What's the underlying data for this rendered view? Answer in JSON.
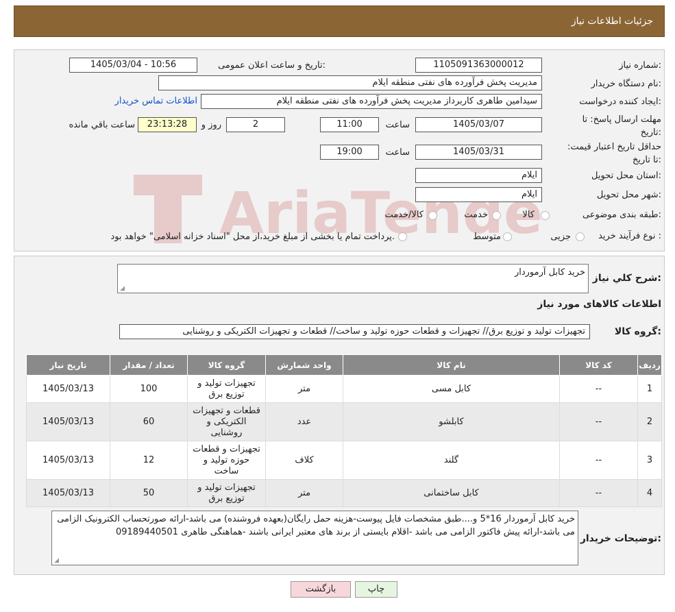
{
  "header": {
    "title": "جزئیات اطلاعات نیاز"
  },
  "fields": {
    "need_number_label": "شماره نیاز:",
    "need_number": "1105091363000012",
    "announce_label": "تاریخ و ساعت اعلان عمومی:",
    "announce_value": "1405/03/04 - 10:56",
    "buyer_org_label": "نام دستگاه خریدار:",
    "buyer_org": "مدیریت پخش فرآورده های نفتی منطقه ایلام",
    "creator_label": "ایجاد کننده درخواست:",
    "creator": "سیدامین طاهری کاربرداز مدیریت پخش فرآورده های نفتی منطقه ایلام",
    "contact_link": "اطلاعات تماس خریدار",
    "reply_deadline_label": "مهلت ارسال پاسخ: تا تاریخ:",
    "reply_date": "1405/03/07",
    "time_label": "ساعت",
    "reply_time": "11:00",
    "days": "2",
    "days_label": "روز و",
    "remaining_time": "23:13:28",
    "remaining_label": "ساعت باقي مانده",
    "price_validity_label": "حداقل تاریخ اعتبار قیمت: تا تاریخ:",
    "price_date": "1405/03/31",
    "price_time": "19:00",
    "province_label": "استان محل تحویل:",
    "province": "ایلام",
    "city_label": "شهر محل تحویل:",
    "city": "ایلام",
    "category_label": "طبقه بندی موضوعی:",
    "category_options": [
      "کالا",
      "خدمت",
      "کالا/خدمت"
    ],
    "process_label": "نوع فرآیند خرید :",
    "process_options": [
      "جزیی",
      "متوسط"
    ],
    "process_note": "پرداخت تمام یا بخشی از مبلغ خرید،از محل \"اسناد خزانه اسلامی\" خواهد بود."
  },
  "summary": {
    "label": "شرح کلي نیاز:",
    "value": "خرید کابل آرموردار",
    "items_title": "اطلاعات کالاهای مورد نیاز",
    "group_label": "گروه کالا:",
    "group_value": "تجهیزات تولید و توزیع برق// تجهیزات و قطعات حوزه تولید و ساخت// قطعات و تجهیزات الکتریکی و روشنایی"
  },
  "table": {
    "headers": [
      "ردیف",
      "کد کالا",
      "نام کالا",
      "واحد شمارش",
      "گروه کالا",
      "تعداد / مقدار",
      "تاریخ نیاز"
    ],
    "rows": [
      [
        "1",
        "--",
        "کابل مسی",
        "متر",
        "تجهیزات تولید و توزیع برق",
        "100",
        "1405/03/13"
      ],
      [
        "2",
        "--",
        "کابلشو",
        "عدد",
        "قطعات و تجهیزات الکتریکی و روشنایی",
        "60",
        "1405/03/13"
      ],
      [
        "3",
        "--",
        "گلند",
        "کلاف",
        "تجهیزات و قطعات حوزه تولید و ساخت",
        "12",
        "1405/03/13"
      ],
      [
        "4",
        "--",
        "کابل ساختمانی",
        "متر",
        "تجهیزات تولید و توزیع برق",
        "50",
        "1405/03/13"
      ]
    ]
  },
  "buyer_notes": {
    "label": "توضیحات خریدار:",
    "value": "خرید کابل آرموردار 16*5 و....طبق مشخصات فایل پیوست-هزینه حمل رایگان(بعهده فروشنده) می باشد-ارائه صورتحساب الکترونیک الزامی می باشد-ارائه پیش فاکتور الزامی می باشد -اقلام بایستی از برند های معتبر ایرانی باشند -هماهنگی طاهری 09189440501"
  },
  "buttons": {
    "print": "چاپ",
    "back": "بازگشت"
  },
  "watermark": {
    "text": "AriaTender.neT"
  },
  "colors": {
    "header": "#8B6534",
    "table_header": "#8a8a8a",
    "back_button": "#f8d7da",
    "print_button": "#e6f5e0"
  },
  "icons": {
    "resize": "resize-grip-icon",
    "radio": "radio-button-icon"
  }
}
